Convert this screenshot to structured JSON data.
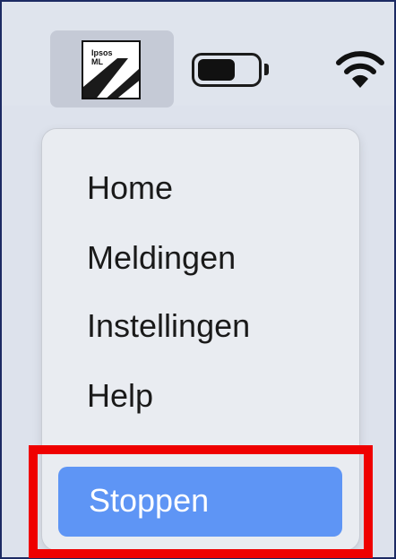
{
  "menubar": {
    "app_icon": {
      "logo_text": "Ipsos\nML",
      "icon": "ipsos-ml-logo-icon"
    },
    "battery": {
      "icon": "battery-icon",
      "level": 0.62
    },
    "wifi": {
      "icon": "wifi-icon"
    }
  },
  "menu": {
    "items": [
      {
        "label": "Home"
      },
      {
        "label": "Meldingen"
      },
      {
        "label": "Instellingen"
      },
      {
        "label": "Help"
      }
    ],
    "stop": {
      "label": "Stoppen"
    }
  },
  "colors": {
    "menubar_bg": "#dfe4ed",
    "menu_bg": "#e9ecf1",
    "stop_highlight": "#5e95f5",
    "annotation_box": "#ef0000"
  }
}
